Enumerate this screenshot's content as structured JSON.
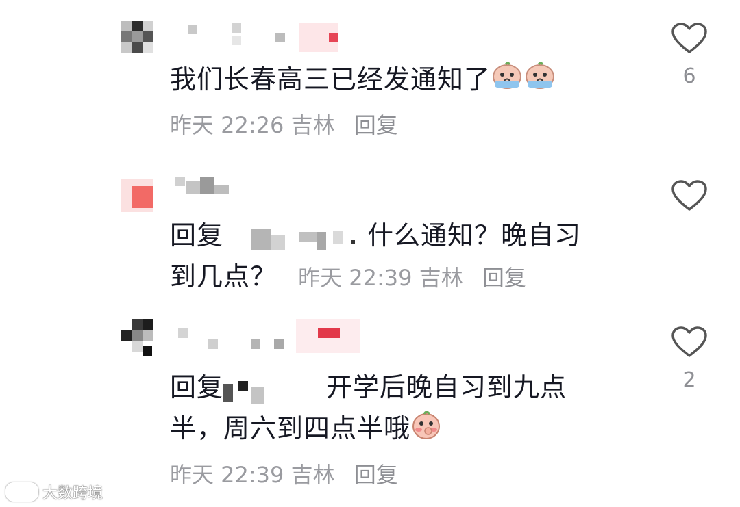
{
  "comments": [
    {
      "text": "我们长春高三已经发通知了",
      "time": "昨天 22:26",
      "location": "吉林",
      "reply": "回复",
      "likes": "6"
    },
    {
      "reply_prefix": "回复",
      "text_tail": "什么通知？晚自习",
      "text_line2": "到几点？",
      "time": "昨天 22:39",
      "location": "吉林",
      "reply": "回复",
      "likes": ""
    },
    {
      "reply_prefix": "回复",
      "text_tail": "开学后晚自习到九点",
      "text_line2": "半，周六到四点半哦",
      "time": "昨天 22:39",
      "location": "吉林",
      "reply": "回复",
      "likes": "2"
    }
  ],
  "watermark": "大数跨境",
  "icons": {
    "like": "heart-icon",
    "emoji_cry": "crying-face-emoji",
    "emoji_shy": "shy-face-emoji"
  },
  "colors": {
    "text": "#161823",
    "meta": "#9a9ba0",
    "heart": "#555555"
  }
}
